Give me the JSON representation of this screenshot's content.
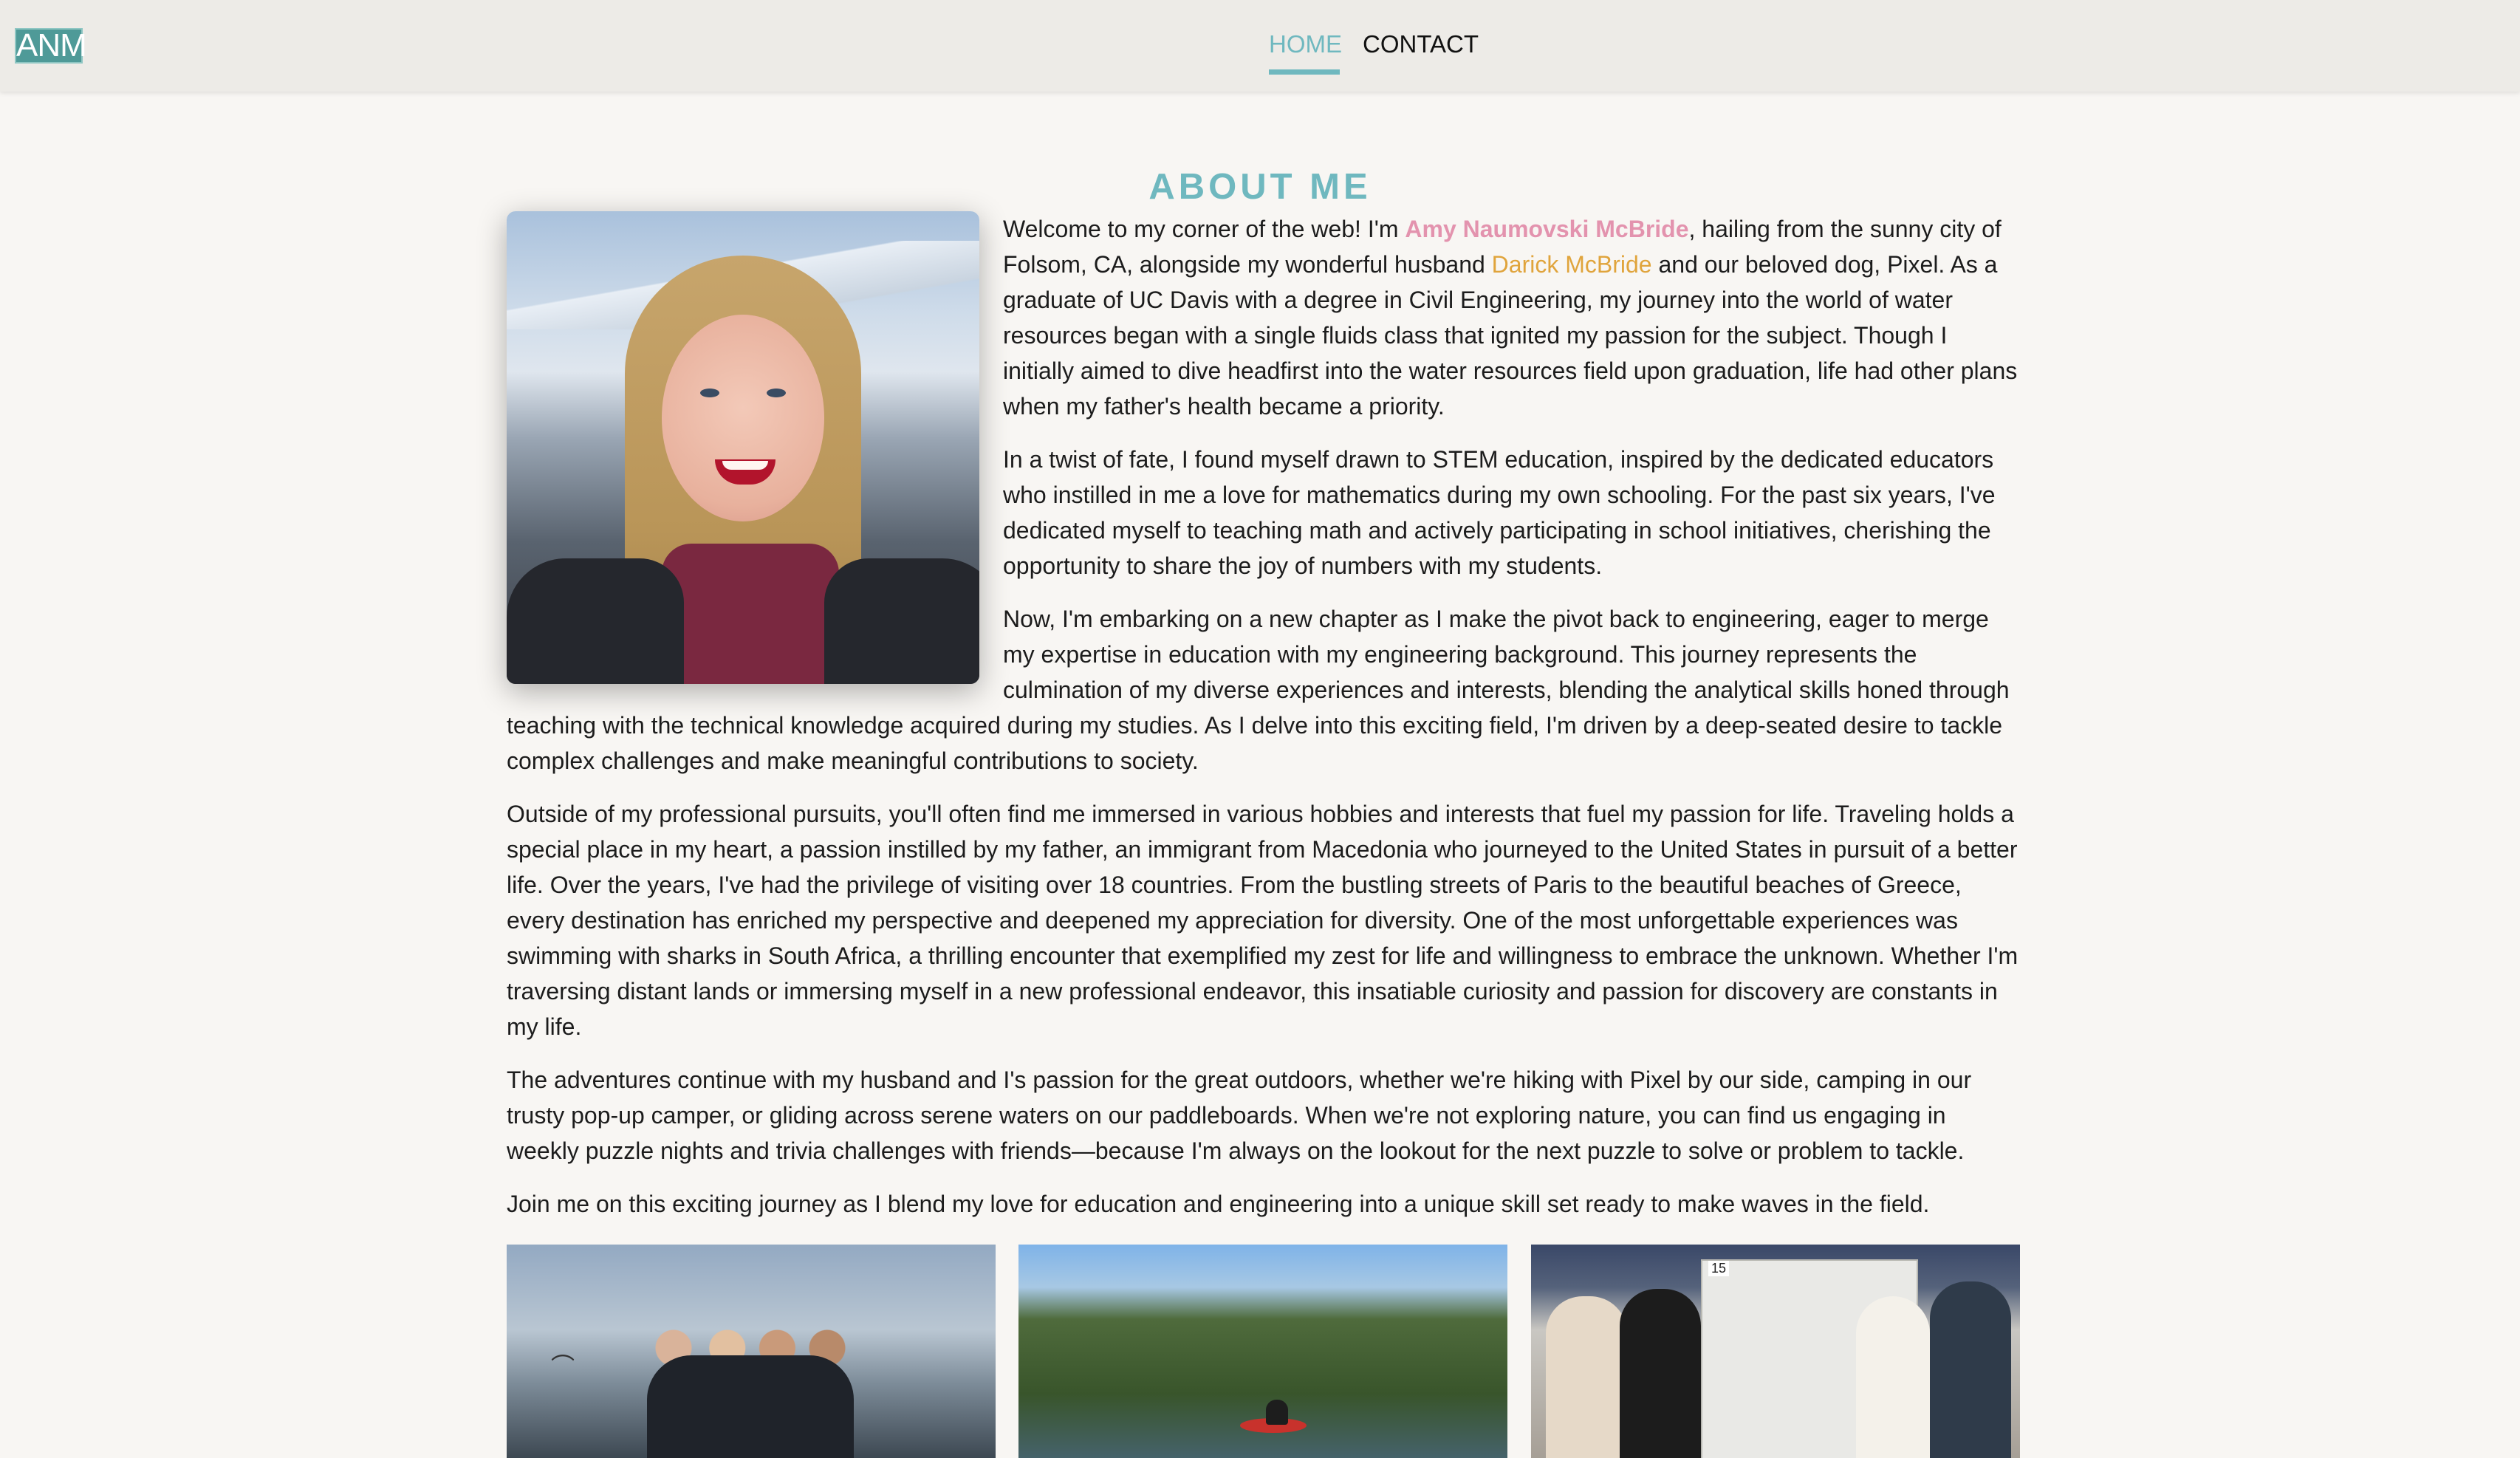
{
  "nav": {
    "logo": "ANM",
    "links": {
      "home": "HOME",
      "contact": "CONTACT"
    },
    "active_color": "#6fb8bf"
  },
  "about": {
    "heading": "ABOUT ME",
    "p1": {
      "before": "Welcome to my corner of the web! I'm ",
      "name1": "Amy Naumovski McBride",
      "mid": ", hailing from the sunny city of Folsom, CA, alongside my wonderful husband ",
      "name2": "Darick McBride",
      "after": " and our beloved dog, Pixel. As a graduate of UC Davis with a degree in Civil Engineering, my journey into the world of water resources began with a single fluids class that ignited my passion for the subject. Though I initially aimed to dive headfirst into the water resources field upon graduation, life had other plans when my father's health became a priority."
    },
    "p2": "In a twist of fate, I found myself drawn to STEM education, inspired by the dedicated educators who instilled in me a love for mathematics during my own schooling. For the past six years, I've dedicated myself to teaching math and actively participating in school initiatives, cherishing the opportunity to share the joy of numbers with my students.",
    "p3": "Now, I'm embarking on a new chapter as I make the pivot back to engineering, eager to merge my expertise in education with my engineering background. This journey represents the culmination of my diverse experiences and interests, blending the analytical skills honed through teaching with the technical knowledge acquired during my studies. As I delve into this exciting field, I'm driven by a deep-seated desire to tackle complex challenges and make meaningful contributions to society.",
    "p4": "Outside of my professional pursuits, you'll often find me immersed in various hobbies and interests that fuel my passion for life. Traveling holds a special place in my heart, a passion instilled by my father, an immigrant from Macedonia who journeyed to the United States in pursuit of a better life. Over the years, I've had the privilege of visiting over 18 countries. From the bustling streets of Paris to the beautiful beaches of Greece, every destination has enriched my perspective and deepened my appreciation for diversity. One of the most unforgettable experiences was swimming with sharks in South Africa, a thrilling encounter that exemplified my zest for life and willingness to embrace the unknown. Whether I'm traversing distant lands or immersing myself in a new professional endeavor, this insatiable curiosity and passion for discovery are constants in my life.",
    "p5": "The adventures continue with my husband and I's passion for the great outdoors, whether we're hiking with Pixel by our side, camping in our trusty pop-up camper, or gliding across serene waters on our paddleboards. When we're not exploring nature, you can find us engaging in weekly puzzle nights and trivia challenges with friends—because I'm always on the lookout for the next puzzle to solve or problem to tackle.",
    "p6": "Join me on this exciting journey as I blend my love for education and engineering into a unique skill set ready to make waves in the field.",
    "name1_color": "#e393ae",
    "name2_color": "#e0a43c"
  },
  "gallery": {
    "poster_number": "15"
  }
}
